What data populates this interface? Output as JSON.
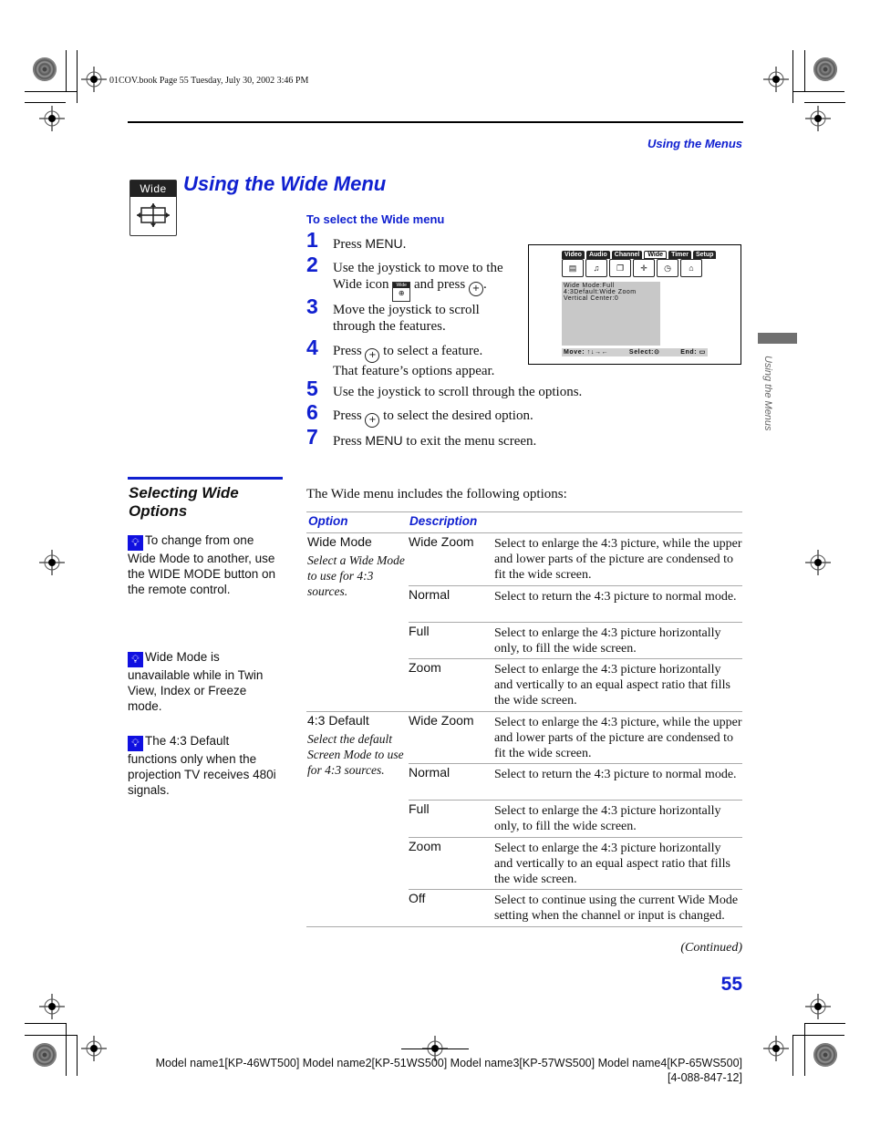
{
  "print_info": "01COV.book  Page 55  Tuesday, July 30, 2002  3:46 PM",
  "header": {
    "section": "Using the Menus"
  },
  "title": {
    "badge_label": "Wide",
    "text": "Using the Wide Menu",
    "icon": "wide-arrows-icon"
  },
  "select_menu": {
    "heading": "To select the Wide menu",
    "steps": [
      {
        "num": "1",
        "parts": [
          "Press ",
          "MENU",
          "."
        ]
      },
      {
        "num": "2",
        "line1": "Use the joystick to move to the",
        "line2_a": "Wide icon",
        "line2_b": "and press",
        "line2_c": "."
      },
      {
        "num": "3",
        "line1": "Move the joystick to scroll",
        "line2": "through the features."
      },
      {
        "num": "4",
        "line1_a": "Press",
        "line1_b": "to select a feature.",
        "line2": "That feature’s options appear."
      },
      {
        "num": "5",
        "text": "Use the joystick to scroll through the options."
      },
      {
        "num": "6",
        "a": "Press",
        "b": "to select the desired option."
      },
      {
        "num": "7",
        "a": "Press ",
        "menu": "MENU",
        "b": " to exit the menu screen."
      }
    ]
  },
  "tv_screen": {
    "tabs": [
      "Video",
      "Audio",
      "Channel",
      "Wide",
      "Timer",
      "Setup"
    ],
    "selected_tab": "Wide",
    "lines": [
      "Wide  Mode:Full",
      "4:3Default:Wide Zoom",
      "Vertical  Center:0"
    ],
    "footer": {
      "move": "Move:",
      "move_arrows": "↑↓→←",
      "select": "Select:",
      "end": "End:"
    }
  },
  "side_tab": {
    "label": "Using the Menus"
  },
  "selecting": {
    "heading": "Selecting Wide Options",
    "tips": [
      "To change from one Wide Mode to another, use the WIDE MODE button on the remote control.",
      "Wide Mode is unavailable while in Twin View, Index or Freeze mode.",
      "The 4:3 Default functions only when the projection TV receives 480i signals."
    ]
  },
  "intro": "The Wide menu includes the following options:",
  "table": {
    "headers": {
      "option": "Option",
      "description": "Description"
    },
    "groups": [
      {
        "name": "Wide Mode",
        "desc": "Select a Wide Mode to use for 4:3 sources.",
        "rows": [
          {
            "value": "Wide Zoom",
            "desc": "Select to enlarge the 4:3 picture, while the upper and lower parts of the picture are condensed to fit the wide screen."
          },
          {
            "value": "Normal",
            "desc": "Select to return the 4:3 picture to normal mode."
          },
          {
            "value": "Full",
            "desc": "Select to enlarge the 4:3 picture horizontally only, to fill the wide screen."
          },
          {
            "value": "Zoom",
            "desc": "Select to enlarge the 4:3 picture horizontally and vertically to an equal aspect ratio that fills the wide screen."
          }
        ]
      },
      {
        "name": "4:3 Default",
        "desc": "Select the default Screen Mode to use for 4:3 sources.",
        "rows": [
          {
            "value": "Wide Zoom",
            "desc": "Select to enlarge the 4:3 picture, while the upper and lower parts of the picture are condensed to fit the wide screen."
          },
          {
            "value": "Normal",
            "desc": "Select to return the 4:3 picture to normal mode."
          },
          {
            "value": "Full",
            "desc": "Select to enlarge the 4:3 picture horizontally only, to fill the wide screen."
          },
          {
            "value": "Zoom",
            "desc": "Select to enlarge the 4:3 picture horizontally and vertically to an equal aspect ratio that fills the wide screen."
          },
          {
            "value": "Off",
            "desc": "Select to continue using the current Wide Mode setting when the channel or input is changed."
          }
        ]
      }
    ]
  },
  "continued": "(Continued)",
  "page_number": "55",
  "footer": {
    "models": "Model name1[KP-46WT500] Model name2[KP-51WS500] Model name3[KP-57WS500] Model name4[KP-65WS500]",
    "part_number": "[4-088-847-12]"
  },
  "colors": {
    "accent_blue": "#1020d0",
    "tip_icon": "#1010e0",
    "side_tab": "#707070"
  }
}
